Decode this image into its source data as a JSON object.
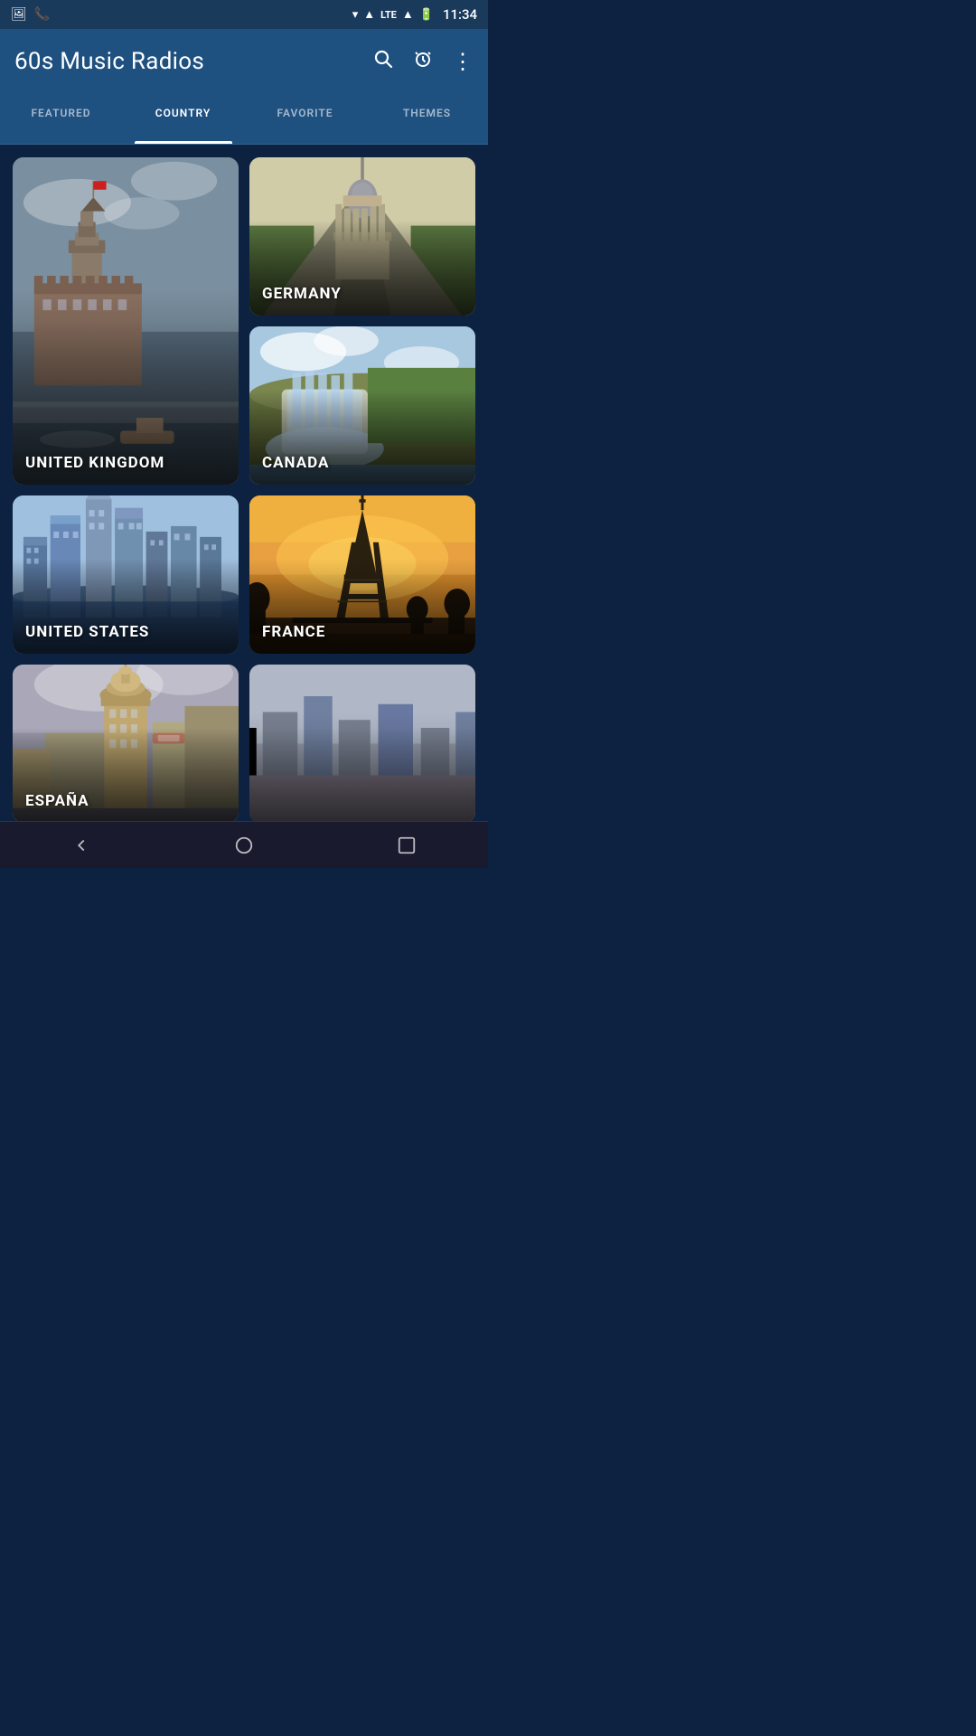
{
  "statusBar": {
    "time": "11:34",
    "icons": [
      "photo-icon",
      "phone-icon",
      "wifi-icon",
      "signal-icon",
      "lte-icon",
      "battery-icon"
    ]
  },
  "header": {
    "title": "60s Music Radios",
    "searchLabel": "search",
    "alarmLabel": "alarm",
    "moreLabel": "more"
  },
  "tabs": [
    {
      "id": "featured",
      "label": "FEATURED",
      "active": false
    },
    {
      "id": "country",
      "label": "COUNTRY",
      "active": true
    },
    {
      "id": "favorite",
      "label": "FAVORITE",
      "active": false
    },
    {
      "id": "themes",
      "label": "THEMES",
      "active": false
    }
  ],
  "countries": [
    {
      "id": "uk",
      "label": "UNITED KINGDOM",
      "tall": true
    },
    {
      "id": "germany",
      "label": "GERMANY",
      "tall": false
    },
    {
      "id": "canada",
      "label": "CANADA",
      "tall": false
    },
    {
      "id": "usa",
      "label": "UNITED STATES",
      "tall": false
    },
    {
      "id": "france",
      "label": "FRANCE",
      "tall": false
    },
    {
      "id": "espana",
      "label": "ESPAÑA",
      "tall": false
    },
    {
      "id": "partial",
      "label": "",
      "tall": false
    }
  ],
  "bottomNav": {
    "backLabel": "◁",
    "homeLabel": "○",
    "recentLabel": "▢"
  }
}
